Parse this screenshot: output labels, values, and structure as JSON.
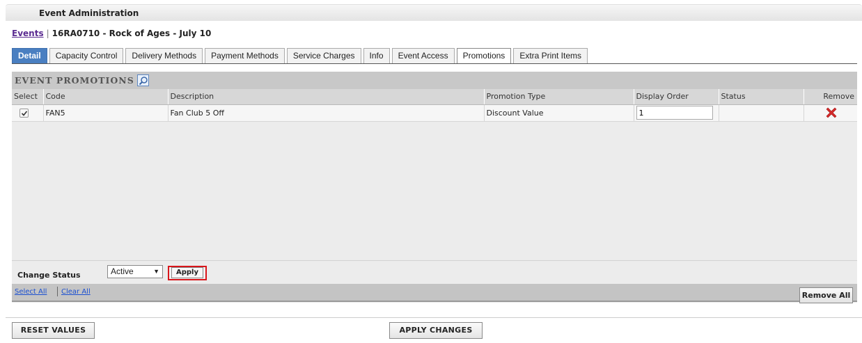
{
  "header": {
    "title": "Event Administration"
  },
  "breadcrumb": {
    "link": "Events",
    "separator": "|",
    "current": "16RA0710 - Rock of Ages - July 10"
  },
  "tabs": [
    {
      "label": "Detail"
    },
    {
      "label": "Capacity Control"
    },
    {
      "label": "Delivery Methods"
    },
    {
      "label": "Payment Methods"
    },
    {
      "label": "Service Charges"
    },
    {
      "label": "Info"
    },
    {
      "label": "Event Access"
    },
    {
      "label": "Promotions"
    },
    {
      "label": "Extra Print Items"
    }
  ],
  "panel": {
    "title": "EVENT PROMOTIONS",
    "columns": [
      "Select",
      "Code",
      "Description",
      "Promotion Type",
      "Display Order",
      "Status",
      "Remove"
    ],
    "rows": [
      {
        "selected": true,
        "code": "FAN5",
        "description": "Fan Club 5 Off",
        "promotion_type": "Discount Value",
        "display_order": "1",
        "status": ""
      }
    ],
    "change_status_label": "Change Status",
    "status_value": "Active",
    "apply_label": "Apply",
    "select_all_label": "Select All",
    "clear_all_label": "Clear All",
    "remove_all_label": "Remove All"
  },
  "footer": {
    "reset_label": "RESET VALUES",
    "apply_changes_label": "APPLY CHANGES"
  },
  "colors": {
    "active_tab": "#4a7fc1",
    "highlight": "#d9161b",
    "remove_icon": "#d42a2a",
    "link": "#1a4fd1"
  }
}
